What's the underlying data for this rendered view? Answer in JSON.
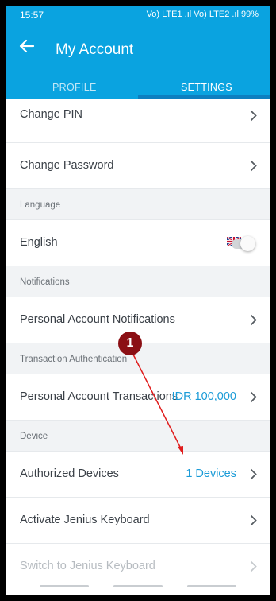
{
  "statusbar": {
    "time": "15:57",
    "indicators": "Vo) LTE1 .ıl Vo) LTE2 .ıl 99%",
    "icons": [
      "mute-icon",
      "wifi-icon",
      "signal-icon",
      "battery-icon"
    ]
  },
  "header": {
    "title": "My Account",
    "back_icon": "arrow-left-icon",
    "tabs": [
      {
        "label": "PROFILE",
        "active": false
      },
      {
        "label": "SETTINGS",
        "active": true
      }
    ]
  },
  "settings": {
    "change_pin": "Change PIN",
    "change_password": "Change Password",
    "language_section": "Language",
    "language_value": "English",
    "language_flag": "uk-flag-icon",
    "notifications_section": "Notifications",
    "personal_notifications": "Personal Account Notifications",
    "transaction_auth_section": "Transaction Authentication",
    "personal_transactions": "Personal Account Transactions",
    "personal_transactions_value": "IDR 100,000",
    "device_section": "Device",
    "authorized_devices": "Authorized Devices",
    "authorized_devices_value": "1 Devices",
    "activate_keyboard": "Activate Jenius Keyboard",
    "switch_keyboard": "Switch to Jenius Keyboard"
  },
  "annotation": {
    "badge_number": "1"
  },
  "colors": {
    "primary": "#0aa3e0",
    "accent_text": "#1a9bd7",
    "annotation": "#8b0f14",
    "arrow": "#e01c1c"
  }
}
